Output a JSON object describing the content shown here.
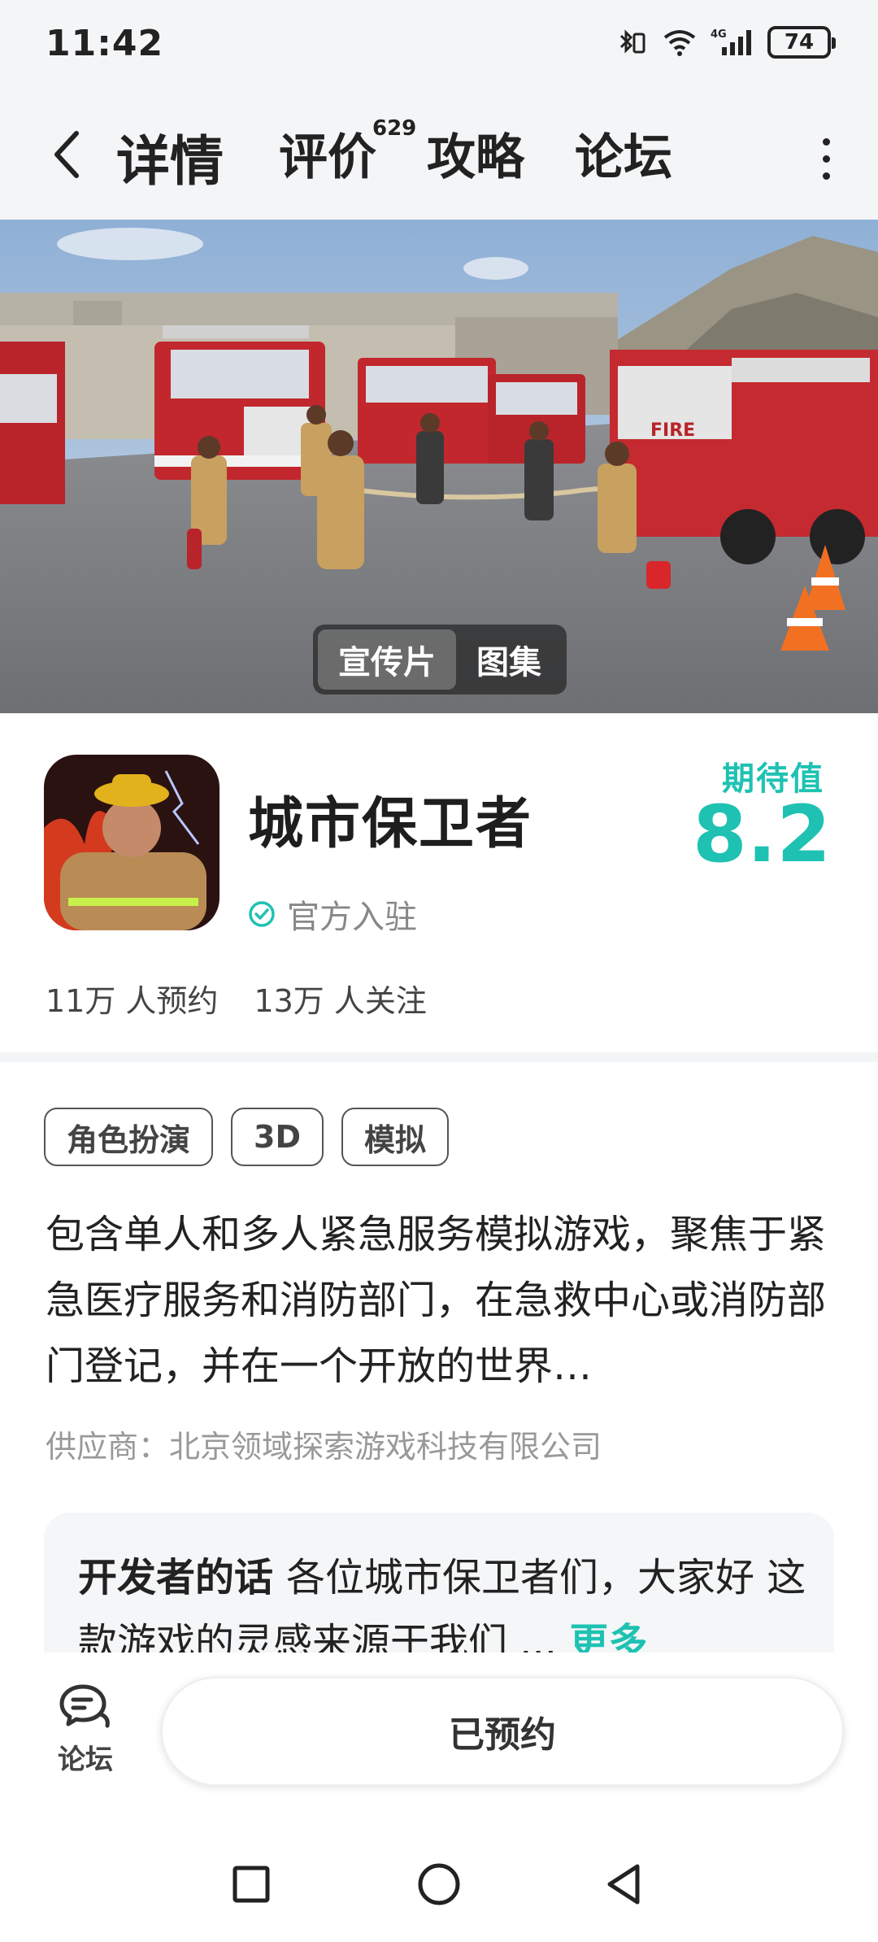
{
  "status_bar": {
    "time": "11:42",
    "battery": "74",
    "network_label": "4G"
  },
  "header": {
    "tabs": [
      {
        "label": "详情",
        "active": true
      },
      {
        "label": "评价",
        "badge": "629"
      },
      {
        "label": "攻略"
      },
      {
        "label": "论坛"
      }
    ]
  },
  "media": {
    "toggle": [
      "宣传片",
      "图集"
    ],
    "truck_text": "FIRE"
  },
  "app": {
    "name": "城市保卫者",
    "official_label": "官方入驻",
    "expect_label": "期待值",
    "expect_score": "8.2",
    "reservations": "11万 人预约",
    "followers": "13万 人关注"
  },
  "tags": [
    "角色扮演",
    "3D",
    "模拟"
  ],
  "description": "包含单人和多人紧急服务模拟游戏，聚焦于紧急医疗服务和消防部门，在急救中心或消防部门登记，并在一个开放的世界…",
  "vendor": "供应商：北京领域探索游戏科技有限公司",
  "developer_note": {
    "title": "开发者的话",
    "text": "各位城市保卫者们，大家好 这款游戏的灵感来源于我们 ...",
    "more": "更多"
  },
  "action_bar": {
    "forum_label": "论坛",
    "reserved_label": "已预约"
  },
  "colors": {
    "accent": "#1fc2b2",
    "background": "#ffffff",
    "header_bg": "#f4f5f7"
  }
}
